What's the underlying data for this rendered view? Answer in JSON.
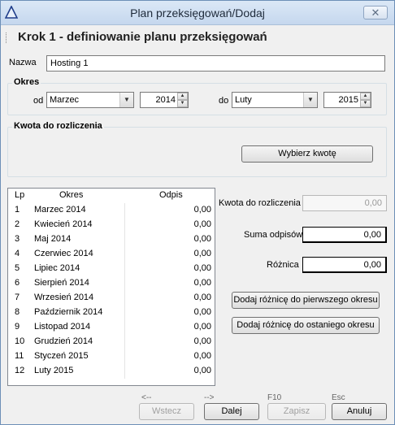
{
  "window": {
    "title": "Plan przeksięgowań/Dodaj",
    "close_symbol": "✕",
    "icon": "warning-triangle-icon"
  },
  "header": {
    "step_title": "Krok 1 - definiowanie planu przeksięgowań"
  },
  "form": {
    "name_label": "Nazwa",
    "name_value": "Hosting 1",
    "period_group": "Okres",
    "from_label": "od",
    "from_month": "Marzec",
    "from_year": "2014",
    "to_label": "do",
    "to_month": "Luty",
    "to_year": "2015",
    "amount_group": "Kwota do rozliczenia",
    "choose_amount_button": "Wybierz kwotę"
  },
  "table": {
    "headers": {
      "lp": "Lp",
      "period": "Okres",
      "writeoff": "Odpis"
    },
    "rows": [
      {
        "lp": "1",
        "period": "Marzec 2014",
        "writeoff": "0,00"
      },
      {
        "lp": "2",
        "period": "Kwiecień 2014",
        "writeoff": "0,00"
      },
      {
        "lp": "3",
        "period": "Maj 2014",
        "writeoff": "0,00"
      },
      {
        "lp": "4",
        "period": "Czerwiec 2014",
        "writeoff": "0,00"
      },
      {
        "lp": "5",
        "period": "Lipiec 2014",
        "writeoff": "0,00"
      },
      {
        "lp": "6",
        "period": "Sierpień 2014",
        "writeoff": "0,00"
      },
      {
        "lp": "7",
        "period": "Wrzesień 2014",
        "writeoff": "0,00"
      },
      {
        "lp": "8",
        "period": "Październik 2014",
        "writeoff": "0,00"
      },
      {
        "lp": "9",
        "period": "Listopad 2014",
        "writeoff": "0,00"
      },
      {
        "lp": "10",
        "period": "Grudzień 2014",
        "writeoff": "0,00"
      },
      {
        "lp": "11",
        "period": "Styczeń 2015",
        "writeoff": "0,00"
      },
      {
        "lp": "12",
        "period": "Luty 2015",
        "writeoff": "0,00"
      }
    ]
  },
  "summary": {
    "amount_label": "Kwota do rozliczenia",
    "amount_value": "0,00",
    "sum_label": "Suma odpisów",
    "sum_value": "0,00",
    "diff_label": "Różnica",
    "diff_value": "0,00",
    "add_diff_first_button": "Dodaj różnicę do pierwszego okresu",
    "add_diff_last_button": "Dodaj różnicę do ostaniego okresu"
  },
  "footer": {
    "back_key": "<--",
    "back_button": "Wstecz",
    "next_key": "-->",
    "next_button": "Dalej",
    "save_key": "F10",
    "save_button": "Zapisz",
    "cancel_key": "Esc",
    "cancel_button": "Anuluj"
  }
}
